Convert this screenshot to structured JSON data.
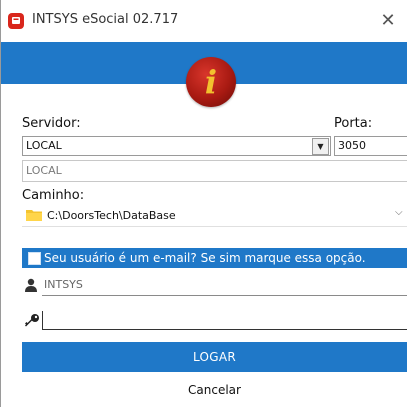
{
  "window": {
    "title": "INTSYS eSocial 02.717",
    "close_glyph": "✕",
    "icon": "app-icon"
  },
  "header": {
    "accent_color": "#1f78c8",
    "logo_icon": "info-icon",
    "logo_glyph": "i"
  },
  "server": {
    "label": "Servidor:",
    "selected_value": "LOCAL",
    "secondary_value": "LOCAL",
    "dropdown_glyph": "▼"
  },
  "port": {
    "label": "Porta:",
    "value": "3050"
  },
  "path": {
    "label": "Caminho:",
    "value": "C:\\DoorsTech\\DataBase",
    "chevron_glyph": "⌵"
  },
  "email_option": {
    "label": "Seu usuário é um e-mail? Se sim marque essa opção.",
    "checked": false
  },
  "user": {
    "value": "INTSYS",
    "icon": "user-icon"
  },
  "password": {
    "value": "",
    "icon": "key-icon"
  },
  "actions": {
    "login_label": "LOGAR",
    "cancel_label": "Cancelar"
  }
}
